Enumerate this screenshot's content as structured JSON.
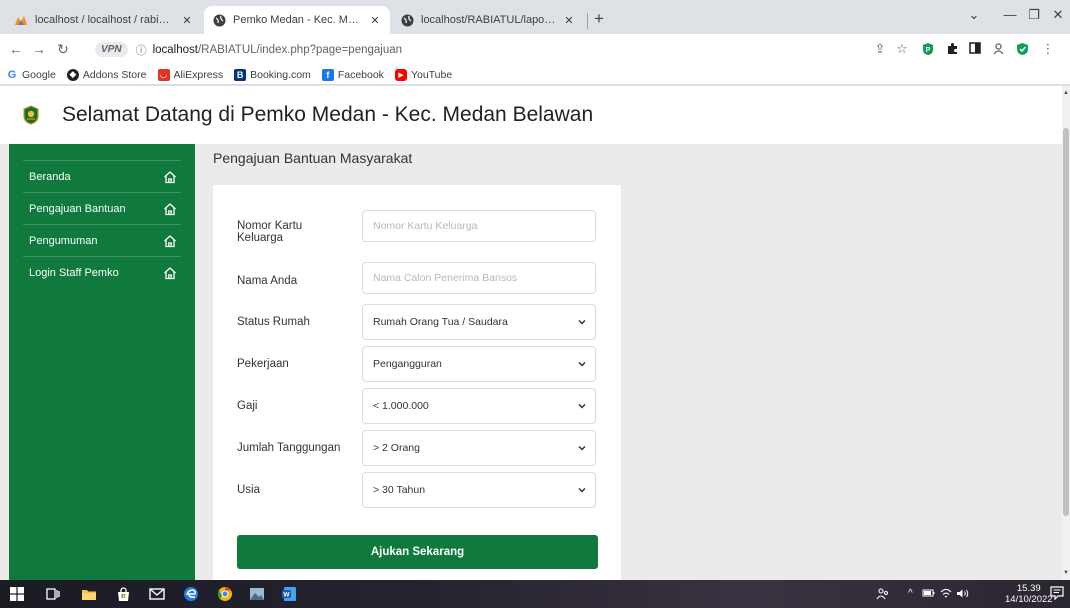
{
  "browser": {
    "tabs": [
      {
        "title": "localhost / localhost / rabiatul | p",
        "active": false
      },
      {
        "title": "Pemko Medan - Kec. Medan Bela",
        "active": true
      },
      {
        "title": "localhost/RABIATUL/laporan_ana",
        "active": false
      }
    ],
    "new_tab": "+",
    "window_controls": {
      "list": "⌄",
      "minimize": "—",
      "restore": "❐",
      "close": "✕"
    },
    "nav": {
      "back": "←",
      "forward": "→",
      "reload": "↻"
    },
    "vpn_badge": "VPN",
    "url_host": "localhost",
    "url_path": "/RABIATUL/index.php?page=pengajuan",
    "bookmarks": [
      {
        "label": "Google",
        "icon": "google-icon",
        "color": "#4285f4"
      },
      {
        "label": "Addons Store",
        "icon": "addons-icon",
        "color": "#202124"
      },
      {
        "label": "AliExpress",
        "icon": "aliexpress-icon",
        "color": "#e43225"
      },
      {
        "label": "Booking.com",
        "icon": "booking-icon",
        "color": "#003580"
      },
      {
        "label": "Facebook",
        "icon": "facebook-icon",
        "color": "#1877f2"
      },
      {
        "label": "YouTube",
        "icon": "youtube-icon",
        "color": "#ff0000"
      }
    ]
  },
  "site": {
    "title": "Selamat Datang di Pemko Medan - Kec. Medan Belawan",
    "accent": "#0f7a3b",
    "sidebar": [
      {
        "label": "Beranda"
      },
      {
        "label": "Pengajuan Bantuan"
      },
      {
        "label": "Pengumuman"
      },
      {
        "label": "Login Staff Pemko"
      }
    ],
    "heading": "Pengajuan Bantuan Masyarakat",
    "form": {
      "nkk_label": "Nomor Kartu Keluarga",
      "nkk_placeholder": "Nomor Kartu Keluarga",
      "nama_label": "Nama Anda",
      "nama_placeholder": "Nama Calon Penerima Bansos",
      "status_label": "Status Rumah",
      "status_value": "Rumah Orang Tua / Saudara",
      "pekerjaan_label": "Pekerjaan",
      "pekerjaan_value": "Pengangguran",
      "gaji_label": "Gaji",
      "gaji_value": "< 1.000.000",
      "tanggungan_label": "Jumlah Tanggungan",
      "tanggungan_value": "> 2 Orang",
      "usia_label": "Usia",
      "usia_value": "> 30 Tahun",
      "submit_label": "Ajukan Sekarang"
    }
  },
  "taskbar": {
    "time": "15.39",
    "date": "14/10/2022"
  }
}
